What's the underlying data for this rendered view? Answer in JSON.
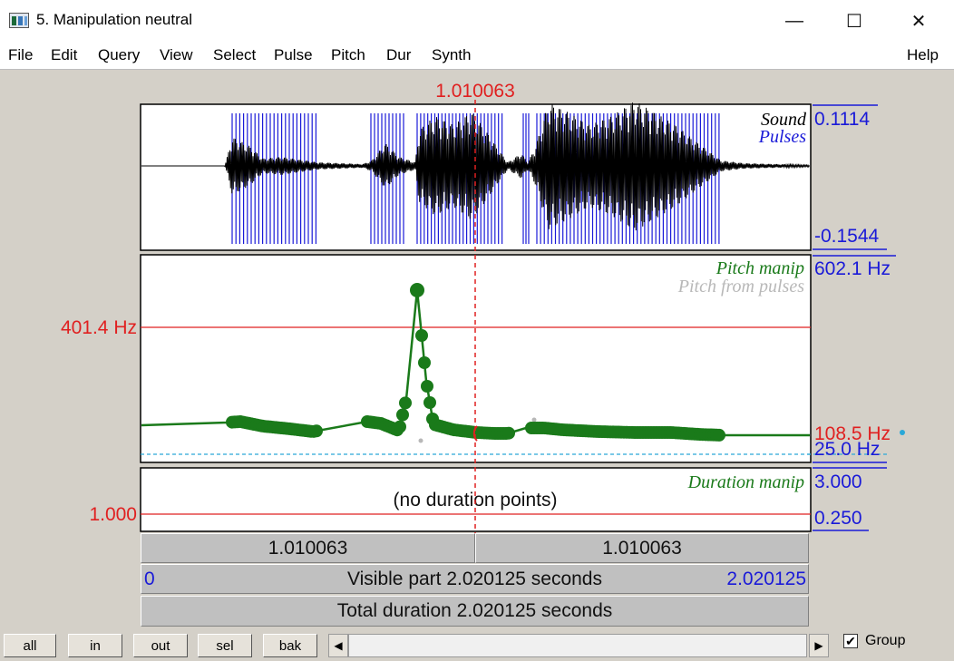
{
  "window": {
    "title": "5. Manipulation neutral",
    "minimize_glyph": "—",
    "maximize_glyph": "☐",
    "close_glyph": "✕"
  },
  "menu": [
    "File",
    "Edit",
    "Query",
    "View",
    "Select",
    "Pulse",
    "Pitch",
    "Dur",
    "Synth"
  ],
  "help_label": "Help",
  "cursor": {
    "time_label": "1.010063",
    "time": 1.010063
  },
  "sound_panel": {
    "label_sound": "Sound",
    "label_pulses": "Pulses",
    "max_label": "0.1114",
    "min_label": "-0.1544"
  },
  "pitch_panel": {
    "label_manip": "Pitch manip",
    "label_from_pulses": "Pitch from pulses",
    "top_label": "602.1 Hz",
    "ref_label": "401.4 Hz",
    "cursor_value_label": "108.5 Hz",
    "bottom_label": "25.0 Hz"
  },
  "duration_panel": {
    "label": "Duration manip",
    "top_label": "3.000",
    "ref_label": "1.000",
    "bottom_label": "0.250",
    "empty_text": "(no duration points)"
  },
  "timebars": {
    "left_segment": "1.010063",
    "right_segment": "1.010063",
    "visible_start": "0",
    "visible_text": "Visible part 2.020125 seconds",
    "visible_end": "2.020125",
    "total_text": "Total duration 2.020125 seconds"
  },
  "buttons": {
    "all": "all",
    "in": "in",
    "out": "out",
    "sel": "sel",
    "bak": "bak",
    "group": "Group",
    "group_checked": "✔"
  },
  "colors": {
    "red": "#e02020",
    "blue": "#1a1ad8",
    "green": "#1a7a1a",
    "cyan": "#2aa8d8",
    "grey": "#b8b8b8"
  }
}
